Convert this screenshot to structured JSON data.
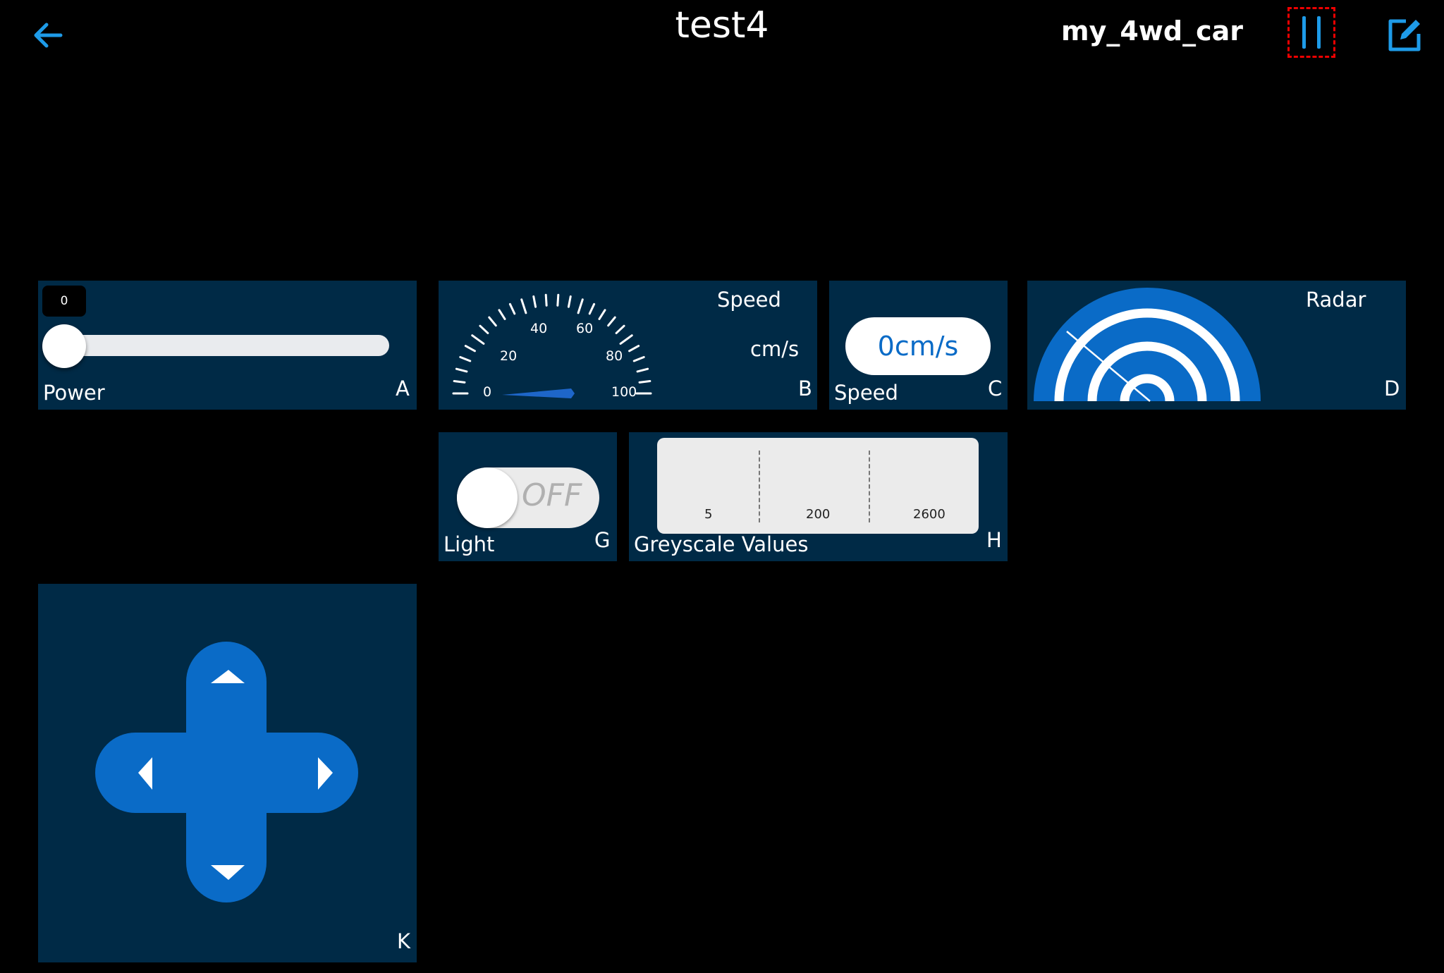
{
  "header": {
    "title": "test4",
    "device_name": "my_4wd_car"
  },
  "widgets": {
    "power": {
      "value": "0",
      "label": "Power",
      "letter": "A",
      "level": 0
    },
    "gauge": {
      "title": "Speed",
      "unit": "cm/s",
      "letter": "B",
      "ticks": [
        "0",
        "20",
        "40",
        "60",
        "80",
        "100"
      ],
      "value": 0
    },
    "speed": {
      "value": "0cm/s",
      "label": "Speed",
      "letter": "C"
    },
    "radar": {
      "title": "Radar",
      "letter": "D"
    },
    "light": {
      "state": "OFF",
      "label": "Light",
      "letter": "G",
      "on": false
    },
    "greyscale": {
      "values": [
        "5",
        "200",
        "2600"
      ],
      "label": "Greyscale Values",
      "letter": "H"
    },
    "dpad": {
      "letter": "K"
    }
  },
  "colors": {
    "accent": "#1e9be8",
    "panel": "#002a46",
    "button_blue": "#0a6bc7",
    "highlight_border": "#e00000"
  },
  "icons": {
    "back": "arrow-left-icon",
    "pause": "pause-icon",
    "edit": "edit-icon"
  }
}
